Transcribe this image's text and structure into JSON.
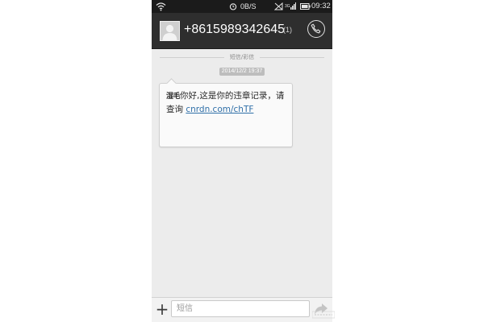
{
  "status_bar": {
    "network_speed": "0B/S",
    "time": "09:32",
    "icons": [
      "wifi-icon",
      "alarm-icon",
      "no-signal-icon",
      "signal-icon",
      "battery-icon"
    ]
  },
  "header": {
    "contact_number": "+8615989342645",
    "message_count": "(1)",
    "icons": [
      "avatar-placeholder",
      "phone-call-icon"
    ]
  },
  "conversation": {
    "type_label": "短信/彩信",
    "timestamp": "2014/12/2 19:37",
    "message": {
      "sender_tag": "湿毛",
      "text": "你好,这是你的违章记录，请查询",
      "link": "cnrdn.com/chTF"
    }
  },
  "compose": {
    "placeholder": "短信",
    "icons": [
      "add-icon",
      "send-icon"
    ]
  },
  "colors": {
    "header_bg": "#2e2e2e",
    "status_bar_bg": "#1b1b1b",
    "conversation_bg": "#ececec",
    "bubble_bg": "#fafafa",
    "link": "#2f6fa8"
  }
}
